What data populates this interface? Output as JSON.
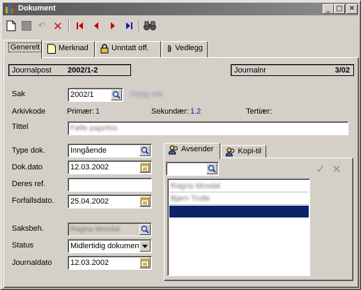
{
  "window": {
    "title": "Dokument"
  },
  "titlebar_buttons": [
    "_",
    "□",
    "✕"
  ],
  "toolbar": {
    "icons": [
      "new-document-icon",
      "save-icon",
      "undo-icon",
      "delete-icon",
      "first-record-icon",
      "previous-record-icon",
      "next-record-icon",
      "last-record-icon",
      "search-binoculars-icon"
    ]
  },
  "tabs": [
    {
      "label": "Generelt",
      "active": true
    },
    {
      "label": "Merknad"
    },
    {
      "label": "Unntatt off."
    },
    {
      "label": "Vedlegg"
    }
  ],
  "header": {
    "journalpost_label": "Journalpost",
    "journalpost_value": "2002/1-2",
    "journalnr_label": "Journalnr",
    "journalnr_value": "3/02"
  },
  "form": {
    "sak_label": "Sak",
    "sak_value": "2002/1",
    "sak_title": "Stygg sak",
    "arkivkode_label": "Arkivkode",
    "primaer_label": "Primær:",
    "primaer_value": "1",
    "sekundaer_label": "Sekundær:",
    "sekundaer_value": "1.2",
    "tertiaer_label": "Tertiær:",
    "tittel_label": "Tittel",
    "tittel_value": "Følle papirliss",
    "type_dok_label": "Type dok.",
    "type_dok_value": "Inngående",
    "dok_dato_label": "Dok.dato",
    "dok_dato_value": "12.03.2002",
    "deres_ref_label": "Deres ref.",
    "deres_ref_value": "",
    "forfallsdato_label": "Forfallsdato.",
    "forfallsdato_value": "25.04.2002",
    "saksbeh_label": "Saksbeh.",
    "saksbeh_value": "Ragna Mosdal",
    "status_label": "Status",
    "status_value": "Midlertidig dokument",
    "journaldato_label": "Journaldato",
    "journaldato_value": "12.03.2002"
  },
  "subtabs": [
    {
      "label": "Avsender",
      "active": true
    },
    {
      "label": "Kopi-til"
    }
  ],
  "recipients": {
    "search_value": "",
    "rows": [
      "Ragna Mosdal",
      "Bjørn Trolle",
      ""
    ]
  },
  "colors": {
    "selection": "#0a246a",
    "accent_blue": "#0a1a9a",
    "delete_red": "#cc1111"
  }
}
